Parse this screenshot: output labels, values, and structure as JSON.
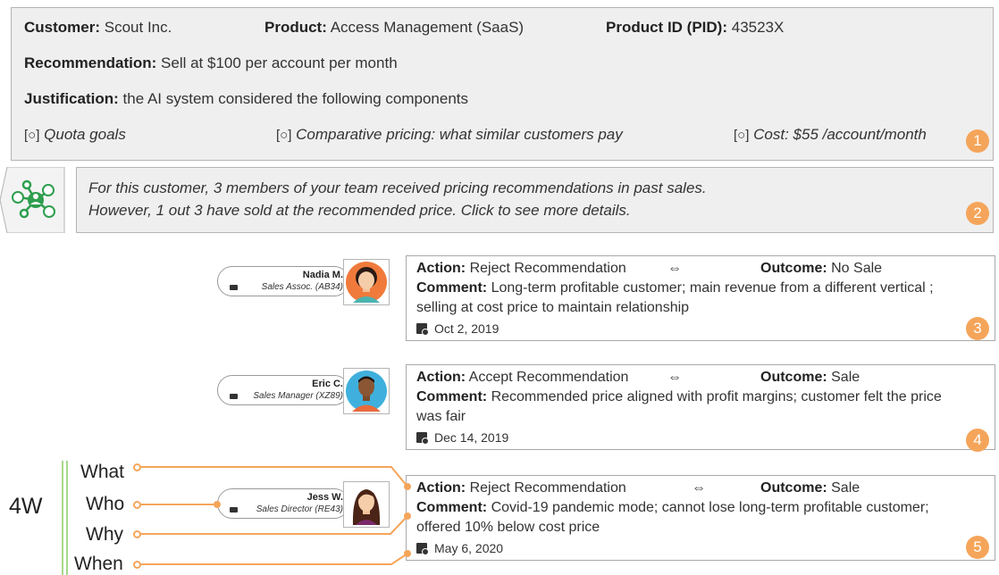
{
  "header": {
    "customer_label": "Customer:",
    "customer_value": "Scout Inc.",
    "product_label": "Product:",
    "product_value": "Access Management (SaaS)",
    "pid_label": "Product ID (PID):",
    "pid_value": "43523X",
    "recommendation_label": "Recommendation:",
    "recommendation_value": "Sell at $100 per account per month",
    "justification_label": "Justification:",
    "justification_value": "the AI system considered the following components",
    "components": [
      {
        "marker": "[○]",
        "text": "Quota goals"
      },
      {
        "marker": "[○]",
        "text": "Comparative pricing: what similar customers pay"
      },
      {
        "marker": "[○]",
        "text": "Cost: $55 /account/month"
      }
    ],
    "badge": "1"
  },
  "team_summary": {
    "icon": "team-network-icon",
    "line1": "For this customer, 3 members of your team received pricing recommendations in past sales.",
    "line2": "However, 1 out 3 have sold at the recommended price. Click to see more details.",
    "badge": "2"
  },
  "records": [
    {
      "name": "Nadia M.",
      "role": "Sales Assoc.  (AB34)",
      "action_label": "Action:",
      "action": "Reject Recommendation",
      "arrow": "⇔",
      "outcome_label": "Outcome:",
      "outcome": "No Sale",
      "comment_label": "Comment:",
      "comment_line1": "Long-term profitable customer; main revenue from a different vertical ;",
      "comment_line2": "selling at cost price to maintain relationship",
      "date": "Oct 2, 2019",
      "badge": "3"
    },
    {
      "name": "Eric C.",
      "role": "Sales Manager (XZ89)",
      "action_label": "Action:",
      "action": "Accept Recommendation",
      "arrow": "⇔",
      "outcome_label": "Outcome:",
      "outcome": "Sale",
      "comment_label": "Comment:",
      "comment_line1": "Recommended price aligned with profit margins; customer felt the price",
      "comment_line2": "was fair",
      "date": "Dec 14, 2019",
      "badge": "4"
    },
    {
      "name": "Jess W.",
      "role": "Sales Director (RE43)",
      "action_label": "Action:",
      "action": "Reject Recommendation",
      "arrow": "⇔",
      "outcome_label": "Outcome:",
      "outcome": "Sale",
      "comment_label": "Comment:",
      "comment_line1": "Covid-19 pandemic mode; cannot lose long-term profitable customer;",
      "comment_line2": "offered 10% below cost price",
      "date": "May 6, 2020",
      "badge": "5"
    }
  ],
  "four_w": {
    "title": "4W",
    "items": [
      "What",
      "Who",
      "Why",
      "When"
    ]
  },
  "colors": {
    "accent": "#f5a55a",
    "panel": "#efefef",
    "network_green": "#2e9e4e"
  }
}
